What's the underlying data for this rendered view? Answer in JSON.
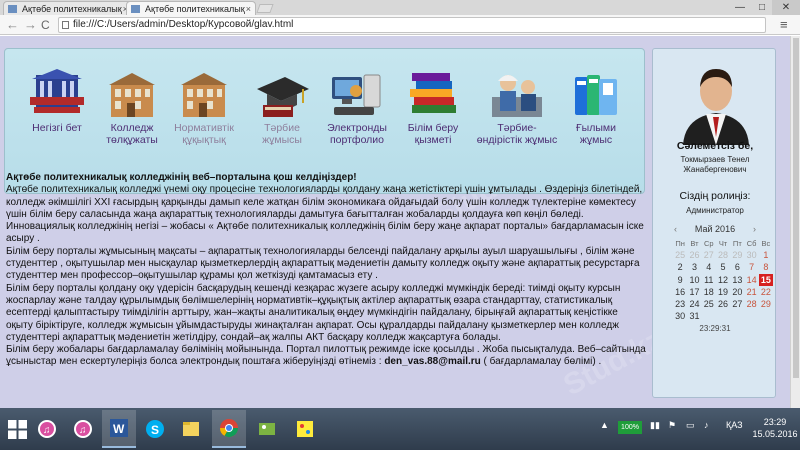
{
  "browser": {
    "tabs": [
      {
        "title": "Ақтөбе политехникалық"
      },
      {
        "title": "Ақтөбе политехникалық"
      }
    ],
    "url": "file:///C:/Users/admin/Desktop/Курсовой/glav.html",
    "win_min": "—",
    "win_max": "□",
    "win_close": "✕",
    "back": "←",
    "forward": "→",
    "reload": "C",
    "menu": "≡",
    "close_glyph": "×"
  },
  "nav": {
    "items": [
      {
        "label": "Негізгі бет",
        "icon": "college-logo-icon"
      },
      {
        "label": "Колледж төлқұжаты",
        "icon": "building-icon"
      },
      {
        "label": "Нормативтік құқықтық",
        "icon": "building-icon"
      },
      {
        "label": "Тәрбие жұмысы",
        "icon": "graduation-cap-icon"
      },
      {
        "label": "Электронды портфолио",
        "icon": "computer-icon"
      },
      {
        "label": "Білім беру қызметі",
        "icon": "books-icon"
      },
      {
        "label": "Тәрбие-өндірістік жұмыс",
        "icon": "workers-icon"
      },
      {
        "label": "Ғылыми жұмыс",
        "icon": "binders-icon"
      }
    ]
  },
  "content": {
    "title": "Ақтөбе политехникалық колледжінің веб–порталына қош келдіңіздер!",
    "p1": "Ақтөбе политехникалық колледжі үнемі оқу процесіне технологияларды қолдану жаңа жетістіктері үшін ұмтылады . Өздеріңіз білетіндей, колледж әкімшілігі XXI ғасырдың қарқынды дамып келе жатқан білім экономикаға ойдағыдай болу үшін колледж түлектеріне көмектесу үшін білім беру саласында жаңа ақпараттық технологияларды дамытуға бағытталған жобаларды қолдауға көп көңіл бөледі.",
    "p2": "Инновациялық колледжінің негізі – жобасы « Ақтөбе политехникалық колледжінің білім беру жаңе ақпарат порталы» бағдарламасын іске асыру .",
    "p3": "Білім беру порталы жұмысының мақсаты – ақпараттық технологияларды белсенді пайдалану арқылы ауыл шаруашылығы , білім және студенттер , оқытушылар мен нысқаулар қызметкерлердің ақпараттық мәдениетін дамыту колледж оқыту және ақпараттық ресурстарға студенттер мен профессор–оқытушылар құрамы қол жеткізуді қамтамасыз ету .",
    "p4": "Білім беру порталы қолдану оқу үдерісін басқарудың кешенді кезқарас жүзеге асыру колледжі мүмкіндік береді: тиімді оқыту курсын жоспарлау және талдау құрылымдық бөлімшелерінің нормативтік–құқықтық актілер ақпараттық өзара стандарттау, статистикалық есептерді қалыптастыру тиімділігін арттыру, жан–жақты аналитикалық өңдеу мүмкіндігін пайдалану, бірыңғай ақпараттық кеңістікке оқыту біріктіруге, колледж жұмысын ұйымдастыруды жинақталған ақпарат. Осы құралдарды пайдалану қызметкерлер мен колледж студенттері ақпараттық мәдениетін жетілдіру, сондай–ақ жалпы АКТ басқару колледж жақсартуға болады.",
    "p5_prefix": "Білім беру жобалары бағдарламалау бөлімінің мойынында. Портал пилоттық режимде іске қосылды . Жоба пысықталуда. Веб–сайтында ұсыныстар мен ескертулеріңіз болса электрондық поштаға жіберуіңізді өтінеміз : ",
    "email": "den_vas.88@mail.ru",
    "p5_suffix": " ( бағдарламалау бөлімі) ."
  },
  "sidebar": {
    "greeting": "Сәлеметсіз бе,",
    "username": "Токмырзаев Тенел Жанабергенович",
    "role_label": "Сіздің ролиңіз:",
    "role_value": "Администратор",
    "calendar": {
      "month": "Май 2016",
      "prev": "‹",
      "next": "›",
      "weekdays": [
        "Пн",
        "Вт",
        "Ср",
        "Чт",
        "Пт",
        "Сб",
        "Вс"
      ],
      "weeks": [
        [
          "25",
          "26",
          "27",
          "28",
          "29",
          "30",
          "1"
        ],
        [
          "2",
          "3",
          "4",
          "5",
          "6",
          "7",
          "8"
        ],
        [
          "9",
          "10",
          "11",
          "12",
          "13",
          "14",
          "15"
        ],
        [
          "16",
          "17",
          "18",
          "19",
          "20",
          "21",
          "22"
        ],
        [
          "23",
          "24",
          "25",
          "26",
          "27",
          "28",
          "29"
        ],
        [
          "30",
          "31",
          "",
          "",
          "",
          "",
          ""
        ]
      ],
      "today": "15",
      "time": "23:29:31"
    }
  },
  "watermark": "Stud.kz",
  "taskbar": {
    "battery": "100%",
    "lang": "ҚАЗ",
    "time": "23:29",
    "date": "15.05.2016"
  }
}
